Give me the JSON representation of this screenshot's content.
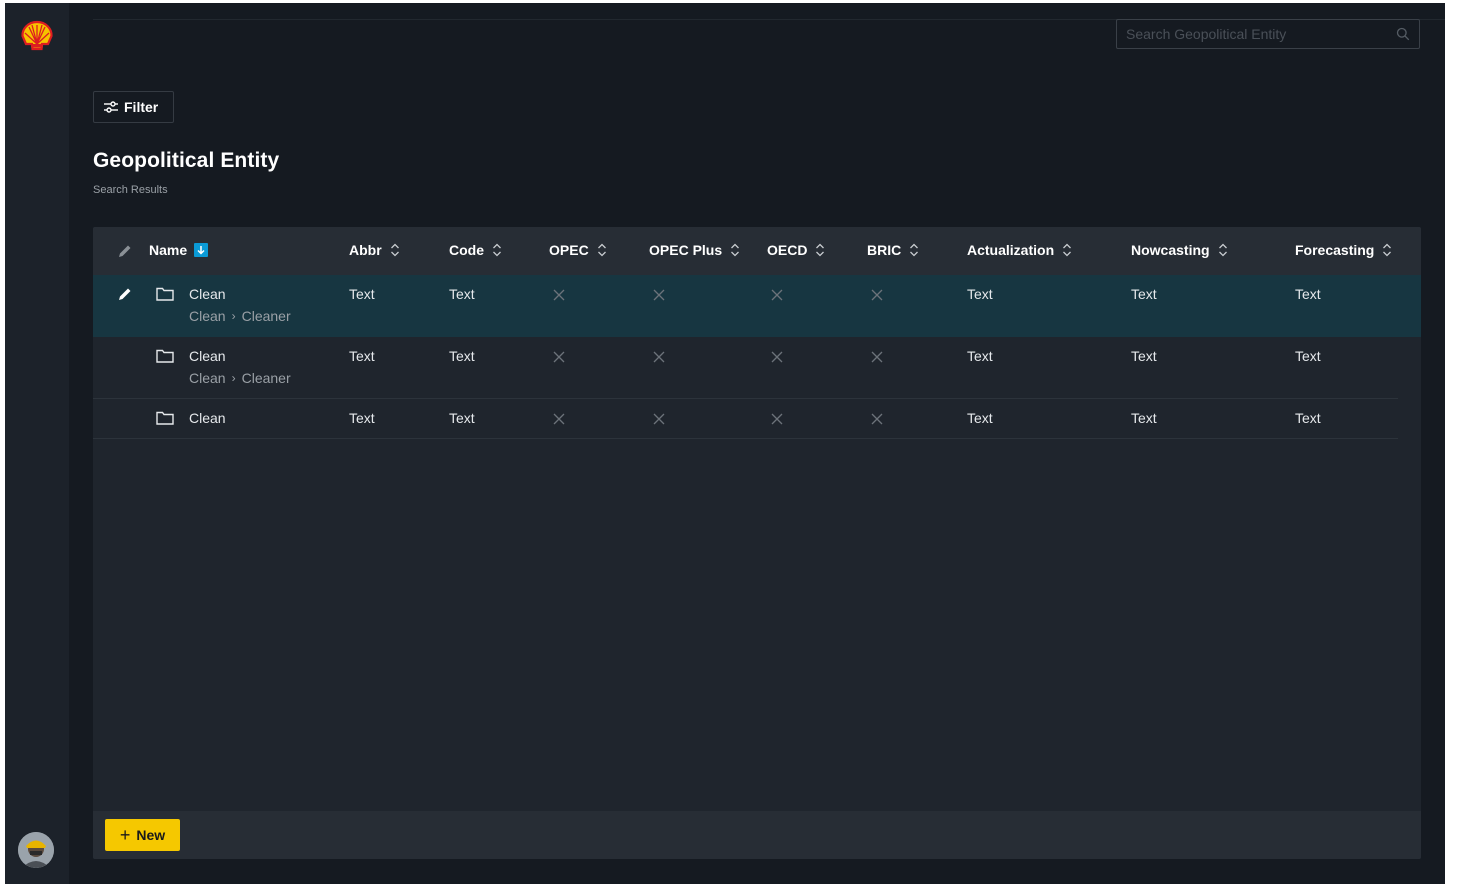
{
  "search": {
    "placeholder": "Search Geopolitical Entity"
  },
  "toolbar": {
    "filter_label": "Filter"
  },
  "page": {
    "title": "Geopolitical Entity",
    "subtitle": "Search Results"
  },
  "table": {
    "columns": [
      "Name",
      "Abbr",
      "Code",
      "OPEC",
      "OPEC Plus",
      "OECD",
      "BRIC",
      "Actualization",
      "Nowcasting",
      "Forecasting"
    ],
    "rows": [
      {
        "name": "Clean",
        "path_parent": "Clean",
        "path_child": "Cleaner",
        "abbr": "Text",
        "code": "Text",
        "actualization": "Text",
        "nowcasting": "Text",
        "forecasting": "Text"
      },
      {
        "name": "Clean",
        "path_parent": "Clean",
        "path_child": "Cleaner",
        "abbr": "Text",
        "code": "Text",
        "actualization": "Text",
        "nowcasting": "Text",
        "forecasting": "Text"
      },
      {
        "name": "Clean",
        "abbr": "Text",
        "code": "Text",
        "actualization": "Text",
        "nowcasting": "Text",
        "forecasting": "Text"
      }
    ]
  },
  "footer": {
    "new_label": "New"
  },
  "colors": {
    "background": "#151a21",
    "panel": "#1f252d",
    "selected_row": "#173641",
    "accent_yellow": "#f5c800",
    "sort_active": "#0a9ad6"
  }
}
